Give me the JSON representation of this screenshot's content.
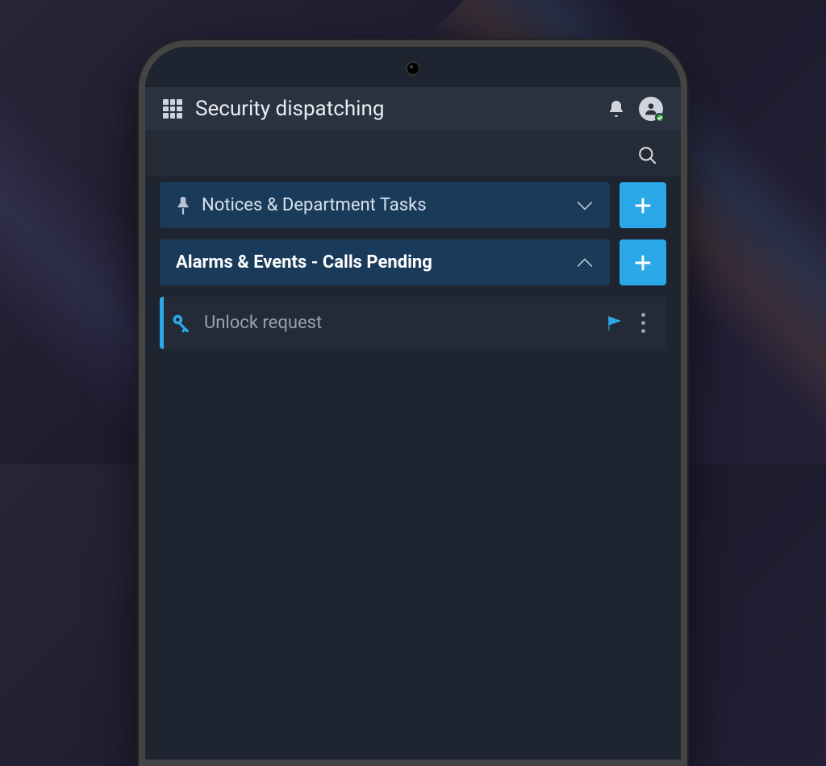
{
  "header": {
    "title": "Security dispatching"
  },
  "sections": [
    {
      "label": "Notices & Department Tasks",
      "pinned": true,
      "expanded": false
    },
    {
      "label": "Alarms & Events - Calls Pending",
      "pinned": false,
      "expanded": true
    }
  ],
  "items": [
    {
      "label": "Unlock request",
      "flagged": true
    }
  ],
  "colors": {
    "accent": "#2aa8e8",
    "panel": "#1a3a5a",
    "bg": "#1e2530"
  }
}
